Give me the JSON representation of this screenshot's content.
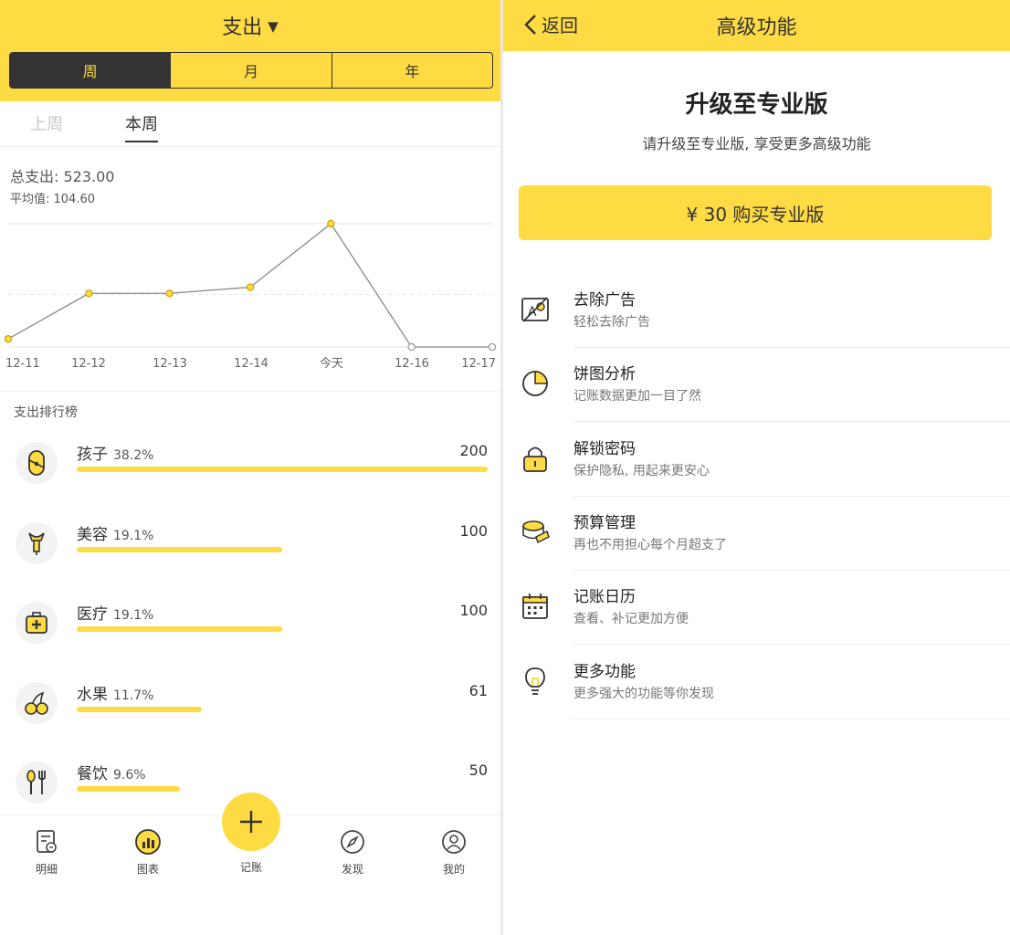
{
  "left": {
    "header": {
      "title": "支出",
      "caret": "▼",
      "segments": [
        "周",
        "月",
        "年"
      ],
      "active_segment": "周"
    },
    "week_tabs": {
      "previous": "上周",
      "current": "本周"
    },
    "stats": {
      "total": "总支出: 523.00",
      "average": "平均值: 104.60"
    },
    "rank_title": "支出排行榜",
    "ranking": [
      {
        "name": "孩子",
        "percent": "38.2%",
        "value": "200",
        "ratio": 1.0,
        "icon": "baby-icon"
      },
      {
        "name": "美容",
        "percent": "19.1%",
        "value": "100",
        "ratio": 0.5,
        "icon": "lipstick-icon"
      },
      {
        "name": "医疗",
        "percent": "19.1%",
        "value": "100",
        "ratio": 0.5,
        "icon": "medical-kit-icon"
      },
      {
        "name": "水果",
        "percent": "11.7%",
        "value": "61",
        "ratio": 0.305,
        "icon": "cherry-icon"
      },
      {
        "name": "餐饮",
        "percent": "9.6%",
        "value": "50",
        "ratio": 0.25,
        "icon": "cutlery-icon"
      }
    ],
    "tabbar": {
      "items": [
        "明细",
        "图表",
        "记账",
        "发现",
        "我的"
      ],
      "active": "图表"
    },
    "colors": {
      "accent": "#fedb43",
      "dark": "#333333"
    }
  },
  "chart_data": {
    "type": "line",
    "categories": [
      "12-11",
      "12-12",
      "12-13",
      "12-14",
      "今天",
      "12-16",
      "12-17"
    ],
    "values": [
      13,
      87,
      87,
      97,
      200,
      0,
      0
    ],
    "ylim": [
      0,
      200
    ],
    "future_points": [
      5,
      6
    ],
    "grid": true
  },
  "right": {
    "header": {
      "back_label": "返回",
      "title": "高级功能"
    },
    "pro_title": "升级至专业版",
    "pro_subtitle": "请升级至专业版, 享受更多高级功能",
    "buy_label": "¥ 30 购买专业版",
    "features": [
      {
        "name": "去除广告",
        "desc": "轻松去除广告",
        "icon": "no-ads-icon"
      },
      {
        "name": "饼图分析",
        "desc": "记账数据更加一目了然",
        "icon": "pie-chart-icon"
      },
      {
        "name": "解锁密码",
        "desc": "保护隐私, 用起来更安心",
        "icon": "lock-icon"
      },
      {
        "name": "预算管理",
        "desc": "再也不用担心每个月超支了",
        "icon": "coins-icon"
      },
      {
        "name": "记账日历",
        "desc": "查看、补记更加方便",
        "icon": "calendar-icon"
      },
      {
        "name": "更多功能",
        "desc": "更多强大的功能等你发现",
        "icon": "lightbulb-icon"
      }
    ]
  }
}
